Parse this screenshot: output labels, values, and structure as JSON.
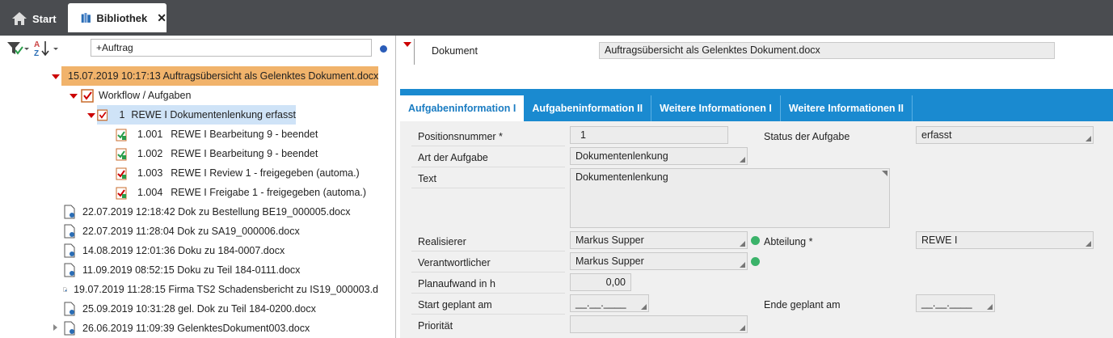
{
  "tabs": {
    "start_label": "Start",
    "library_label": "Bibliothek",
    "close_glyph": "✕"
  },
  "toolbar": {
    "search_value": "+Auftrag",
    "sort_label": "AZ"
  },
  "tree": {
    "root": "15.07.2019 10:17:13 Auftragsübersicht als Gelenktes Dokument.docx",
    "workflow": "Workflow / Aufgaben",
    "task": {
      "num": "1",
      "label": "REWE I Dokumentenlenkung erfasst"
    },
    "subtasks": [
      {
        "num": "1.001",
        "label": "REWE I Bearbeitung 9 - beendet"
      },
      {
        "num": "1.002",
        "label": "REWE I Bearbeitung 9 - beendet"
      },
      {
        "num": "1.003",
        "label": "REWE I Review 1 - freigegeben (automa.)"
      },
      {
        "num": "1.004",
        "label": "REWE I Freigabe 1 - freigegeben (automa.)"
      }
    ],
    "documents": [
      "22.07.2019 12:18:42 Dok zu Bestellung BE19_000005.docx",
      "22.07.2019 11:28:04 Dok zu SA19_000006.docx",
      "14.08.2019 12:01:36 Doku zu 184-0007.docx",
      "11.09.2019 08:52:15 Doku zu Teil 184-0111.docx",
      "19.07.2019 11:28:15 Firma TS2 Schadensbericht zu IS19_000003.d",
      "25.09.2019 10:31:28 gel. Dok zu Teil 184-0200.docx",
      "26.06.2019 11:09:39 GelenktesDokument003.docx"
    ]
  },
  "document": {
    "label": "Dokument",
    "value": "Auftragsübersicht als Gelenktes Dokument.docx"
  },
  "detail_tabs": [
    "Aufgabeninformation I",
    "Aufgabeninformation II",
    "Weitere Informationen I",
    "Weitere Informationen II"
  ],
  "form": {
    "positionsnummer_label": "Positionsnummer *",
    "positionsnummer_value": "1",
    "status_label": "Status der Aufgabe",
    "status_value": "erfasst",
    "art_label": "Art der Aufgabe",
    "art_value": "Dokumentenlenkung",
    "text_label": "Text",
    "text_value": "Dokumentenlenkung",
    "realisierer_label": "Realisierer",
    "realisierer_value": "Markus Supper",
    "abteilung_label": "Abteilung *",
    "abteilung_value": "REWE I",
    "verantwortlicher_label": "Verantwortlicher",
    "verantwortlicher_value": "Markus Supper",
    "planaufwand_label": "Planaufwand in h",
    "planaufwand_value": "0,00",
    "start_label": "Start geplant am",
    "start_value": "__.__.____",
    "ende_label": "Ende geplant am",
    "ende_value": "__.__.____",
    "prioritaet_label": "Priorität",
    "prioritaet_value": ""
  },
  "colors": {
    "topbar": "#4a4c50",
    "accent_blue": "#1a8ad0",
    "selected_orange": "#f1b36b",
    "selected_blue": "#cfe3f7",
    "status_green": "#3bb36a"
  }
}
